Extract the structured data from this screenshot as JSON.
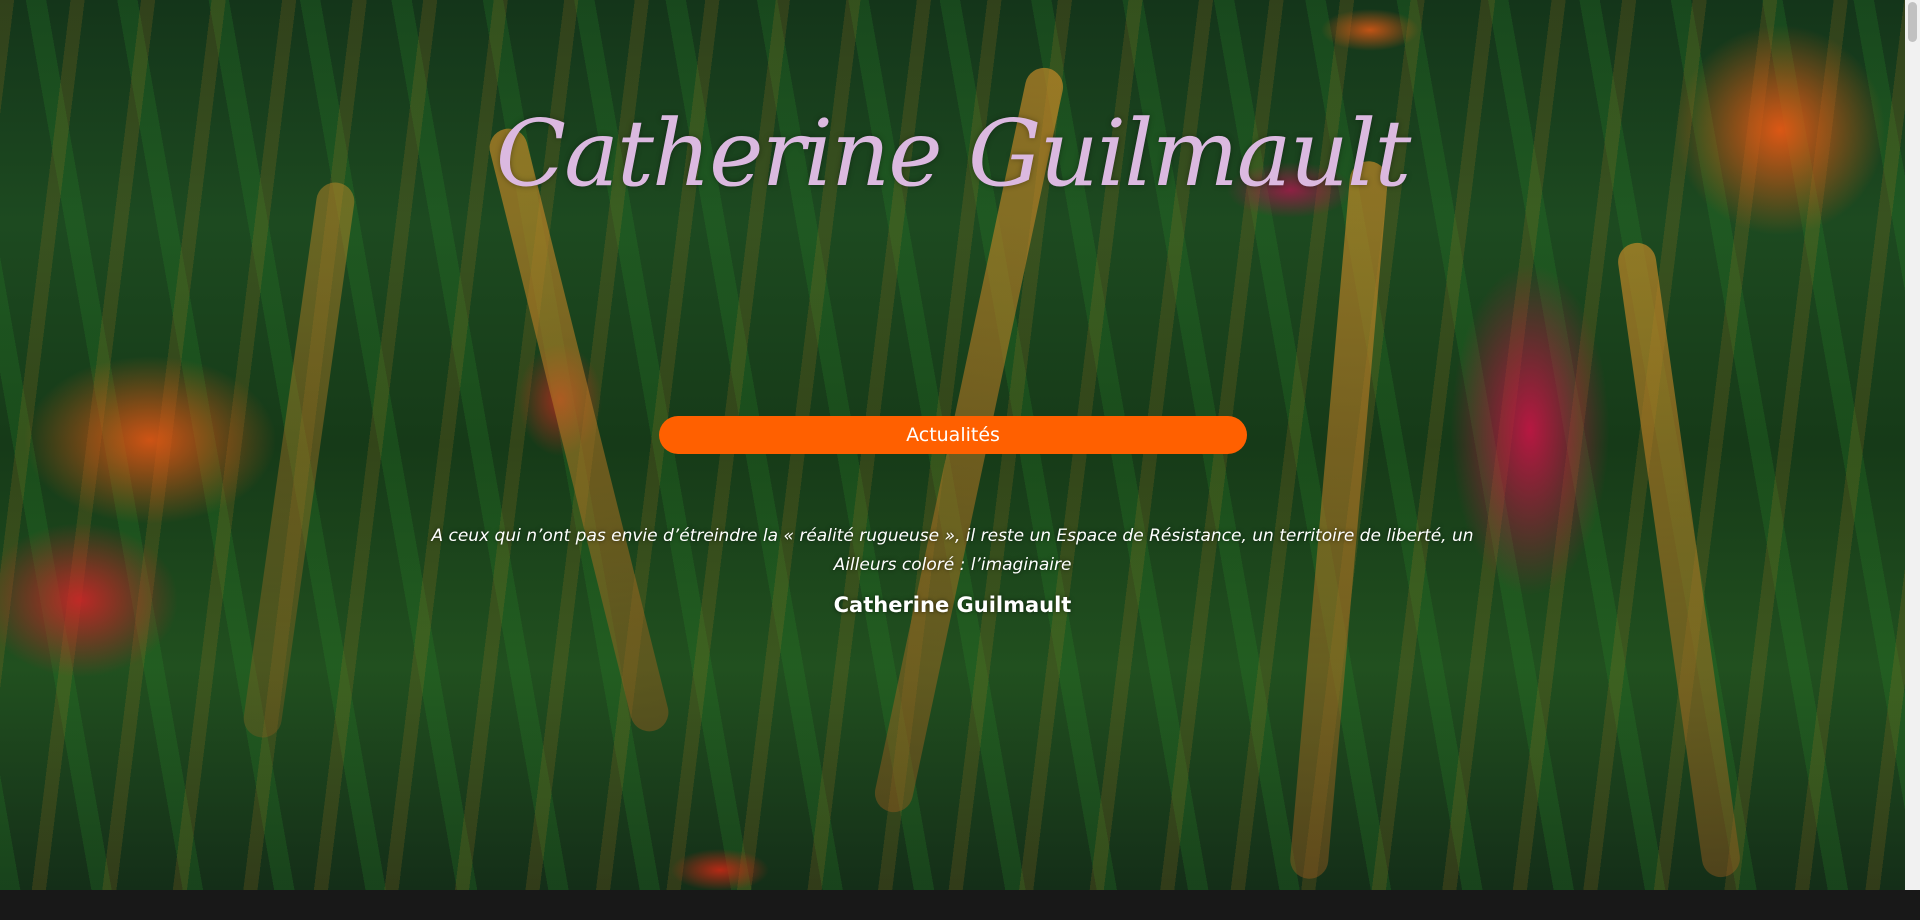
{
  "header": {
    "site_title": "Catherine Guilmault"
  },
  "hero": {
    "news_button_label": "Actualités",
    "quote": "A ceux qui n’ont pas envie d’étreindre la « réalité rugueuse », il reste un Espace de Résistance, un territoire de liberté, un Ailleurs coloré : l’imaginaire",
    "quote_author": "Catherine Guilmault"
  },
  "colors": {
    "title": "#dbb9e0",
    "button": "#ff6000",
    "text": "#ffffff",
    "footer_bar": "#181818"
  }
}
